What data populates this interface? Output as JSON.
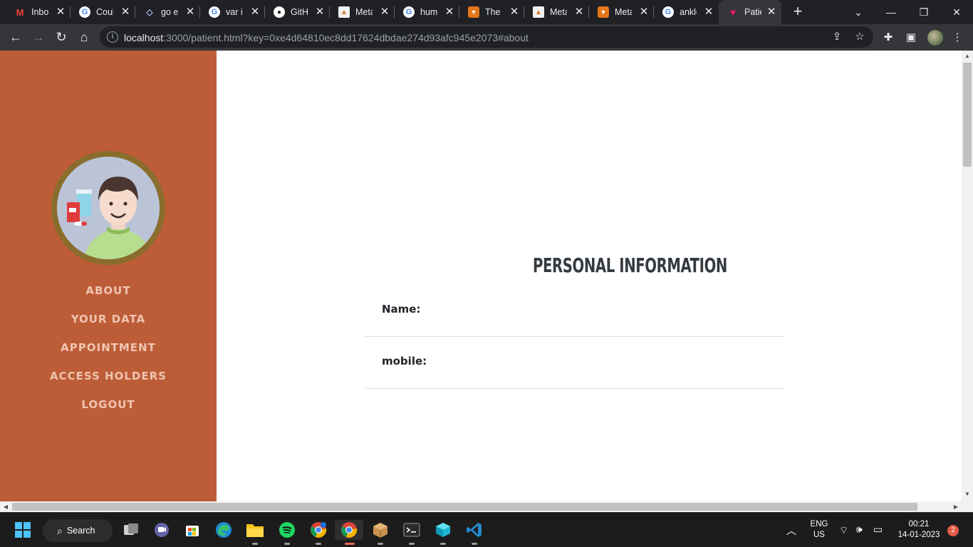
{
  "browser": {
    "tabs": [
      {
        "title": "Inbox",
        "icon": "gmail-icon"
      },
      {
        "title": "Coul",
        "icon": "google-icon"
      },
      {
        "title": "go et",
        "icon": "ethereum-icon"
      },
      {
        "title": "var ip",
        "icon": "google-icon"
      },
      {
        "title": "GitHu",
        "icon": "github-icon"
      },
      {
        "title": "Meta",
        "icon": "metamask-store-icon"
      },
      {
        "title": "huml",
        "icon": "google-icon"
      },
      {
        "title": "The c",
        "icon": "metamask-fox-icon"
      },
      {
        "title": "Meta",
        "icon": "metamask-store-icon"
      },
      {
        "title": "Meta",
        "icon": "metamask-fox-icon"
      },
      {
        "title": "ankle",
        "icon": "google-icon"
      },
      {
        "title": "Patie",
        "icon": "heartbeat-icon"
      }
    ],
    "address": {
      "host": "localhost",
      "rest": ":3000/patient.html?key=0xe4d64810ec8dd17624dbdae274d93afc945e2073#about"
    }
  },
  "sidebar": {
    "avatar_alt": "patient-avatar",
    "nav": [
      {
        "label": "ABOUT"
      },
      {
        "label": "YOUR DATA"
      },
      {
        "label": "APPOINTMENT"
      },
      {
        "label": "ACCESS HOLDERS"
      },
      {
        "label": "LOGOUT"
      }
    ]
  },
  "main": {
    "section_title": "PERSONAL INFORMATION",
    "fields": [
      {
        "label": "Name:",
        "value": ""
      },
      {
        "label": "mobile:",
        "value": ""
      }
    ]
  },
  "taskbar": {
    "search_label": "Search",
    "language": "ENG",
    "region": "US",
    "time": "00:21",
    "date": "14-01-2023",
    "notification_count": "2"
  },
  "colors": {
    "sidebar_bg": "#bd5d38",
    "nav_text": "#f0c5b1",
    "avatar_ring": "#8a6d2c",
    "title_text": "#343a40"
  }
}
